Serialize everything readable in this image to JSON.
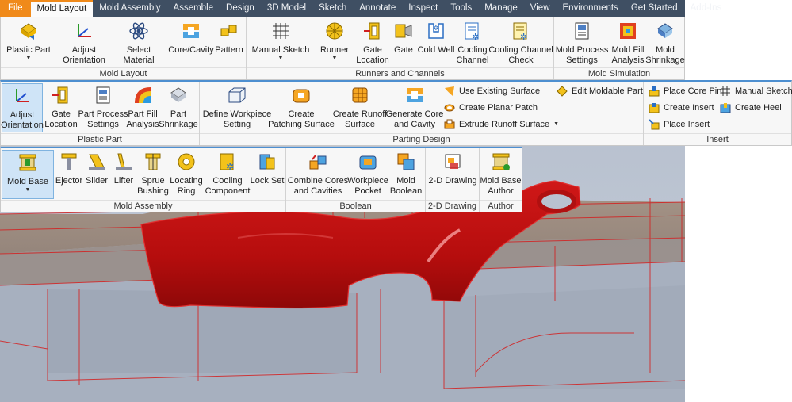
{
  "tabs": [
    "File",
    "Mold Layout",
    "Mold Assembly",
    "Assemble",
    "Design",
    "3D Model",
    "Sketch",
    "Annotate",
    "Inspect",
    "Tools",
    "Manage",
    "View",
    "Environments",
    "Get Started",
    "Add-Ins"
  ],
  "ribbon1": {
    "panels": {
      "mold_layout": {
        "title": "Mold Layout",
        "buttons": {
          "plastic_part": "Plastic Part",
          "adjust_orientation": "Adjust\nOrientation",
          "select_material": "Select Material",
          "core_cavity": "Core/Cavity",
          "pattern": "Pattern"
        }
      },
      "runners": {
        "title": "Runners and Channels",
        "buttons": {
          "manual_sketch": "Manual Sketch",
          "runner": "Runner",
          "gate_location": "Gate\nLocation",
          "gate": "Gate",
          "cold_well": "Cold Well",
          "cooling_channel": "Cooling\nChannel",
          "cooling_channel_check": "Cooling Channel\nCheck"
        }
      },
      "simulation": {
        "title": "Mold Simulation",
        "buttons": {
          "process_settings": "Mold Process\nSettings",
          "fill_analysis": "Mold Fill\nAnalysis",
          "shrinkage": "Mold\nShrinkage"
        }
      }
    }
  },
  "ribbon2": {
    "panels": {
      "plastic_part": {
        "title": "Plastic Part",
        "buttons": {
          "adjust_orientation": "Adjust\nOrientation",
          "gate_location": "Gate\nLocation",
          "process_settings": "Part Process\nSettings",
          "fill_analysis": "Part Fill\nAnalysis",
          "shrinkage": "Part\nShrinkage"
        }
      },
      "parting": {
        "title": "Parting Design",
        "buttons": {
          "define_workpiece": "Define Workpiece\nSetting",
          "create_patching": "Create\nPatching Surface",
          "create_runoff": "Create Runoff\nSurface",
          "generate_core": "Generate Core\nand Cavity",
          "use_existing": "Use Existing Surface",
          "create_planar": "Create Planar Patch",
          "extrude_runoff": "Extrude Runoff Surface",
          "edit_moldable": "Edit Moldable Part"
        }
      },
      "insert": {
        "title": "Insert",
        "buttons": {
          "place_core_pin": "Place Core Pin",
          "create_insert": "Create Insert",
          "place_insert": "Place Insert",
          "manual_sketch": "Manual Sketch",
          "create_heel": "Create Heel"
        }
      }
    }
  },
  "ribbon3": {
    "panels": {
      "mold_assembly": {
        "title": "Mold Assembly",
        "buttons": {
          "mold_base": "Mold Base",
          "ejector": "Ejector",
          "slider": "Slider",
          "lifter": "Lifter",
          "sprue_bushing": "Sprue\nBushing",
          "locating_ring": "Locating\nRing",
          "cooling_component": "Cooling\nComponent",
          "lock_set": "Lock Set"
        }
      },
      "boolean": {
        "title": "Boolean",
        "buttons": {
          "combine": "Combine Cores\nand Cavities",
          "workpiece_pocket": "Workpiece\nPocket",
          "mold_boolean": "Mold\nBoolean"
        }
      },
      "drawing": {
        "title": "2-D Drawing",
        "buttons": {
          "drawing_2d": "2-D Drawing"
        }
      },
      "author": {
        "title": "Author",
        "buttons": {
          "mold_base_author": "Mold Base\nAuthor"
        }
      }
    }
  },
  "colors": {
    "tabbar": "#3f4f63",
    "file_tab": "#f08a1a",
    "part_red": "#c81414",
    "mold_tan": "#9c8878",
    "mold_blue": "#a9b4c4"
  }
}
